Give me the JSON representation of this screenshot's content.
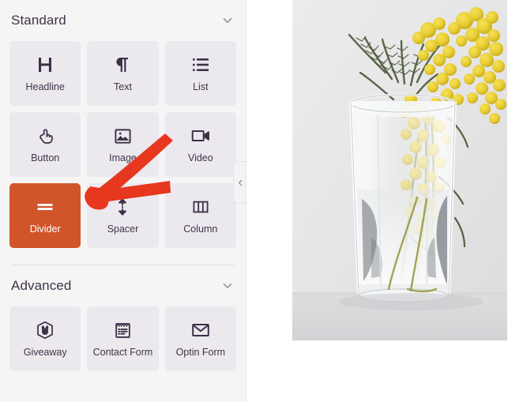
{
  "sidebar": {
    "sections": [
      {
        "id": "standard",
        "title": "Standard",
        "toggle_icon": "chevron-down-icon",
        "tiles": [
          {
            "id": "headline",
            "label": "Headline",
            "icon": "headline-icon",
            "active": false
          },
          {
            "id": "text",
            "label": "Text",
            "icon": "paragraph-icon",
            "active": false
          },
          {
            "id": "list",
            "label": "List",
            "icon": "list-icon",
            "active": false
          },
          {
            "id": "button",
            "label": "Button",
            "icon": "tap-hand-icon",
            "active": false
          },
          {
            "id": "image",
            "label": "Image",
            "icon": "image-icon",
            "active": false
          },
          {
            "id": "video",
            "label": "Video",
            "icon": "video-camera-icon",
            "active": false
          },
          {
            "id": "divider",
            "label": "Divider",
            "icon": "divider-icon",
            "active": true
          },
          {
            "id": "spacer",
            "label": "Spacer",
            "icon": "spacer-arrows-icon",
            "active": false
          },
          {
            "id": "column",
            "label": "Column",
            "icon": "columns-icon",
            "active": false
          }
        ]
      },
      {
        "id": "advanced",
        "title": "Advanced",
        "toggle_icon": "chevron-down-icon",
        "tiles": [
          {
            "id": "giveaway",
            "label": "Giveaway",
            "icon": "rabbit-badge-icon",
            "active": false
          },
          {
            "id": "contact-form",
            "label": "Contact Form",
            "icon": "form-clipboard-icon",
            "active": false
          },
          {
            "id": "optin-form",
            "label": "Optin Form",
            "icon": "envelope-icon",
            "active": false
          }
        ]
      }
    ],
    "collapse_handle": {
      "icon": "chevron-left-icon",
      "label": "Collapse panel"
    }
  },
  "canvas": {
    "image_block": {
      "icon": "photo-block",
      "alt": "Glass vase with yellow mimosa flowers"
    }
  },
  "annotation": {
    "arrow": {
      "icon": "red-arrow-annotation",
      "color": "#E8371F",
      "points_from": "image-tile",
      "points_to": "divider-tile"
    }
  },
  "colors": {
    "sidebar_bg": "#F5F5F5",
    "tile_bg": "#EBE9EE",
    "tile_active_bg": "#D1552A",
    "icon": "#3D3048",
    "text": "#3F3349",
    "annotation_red": "#E8371F",
    "canvas_bg": "#FFFFFF"
  }
}
